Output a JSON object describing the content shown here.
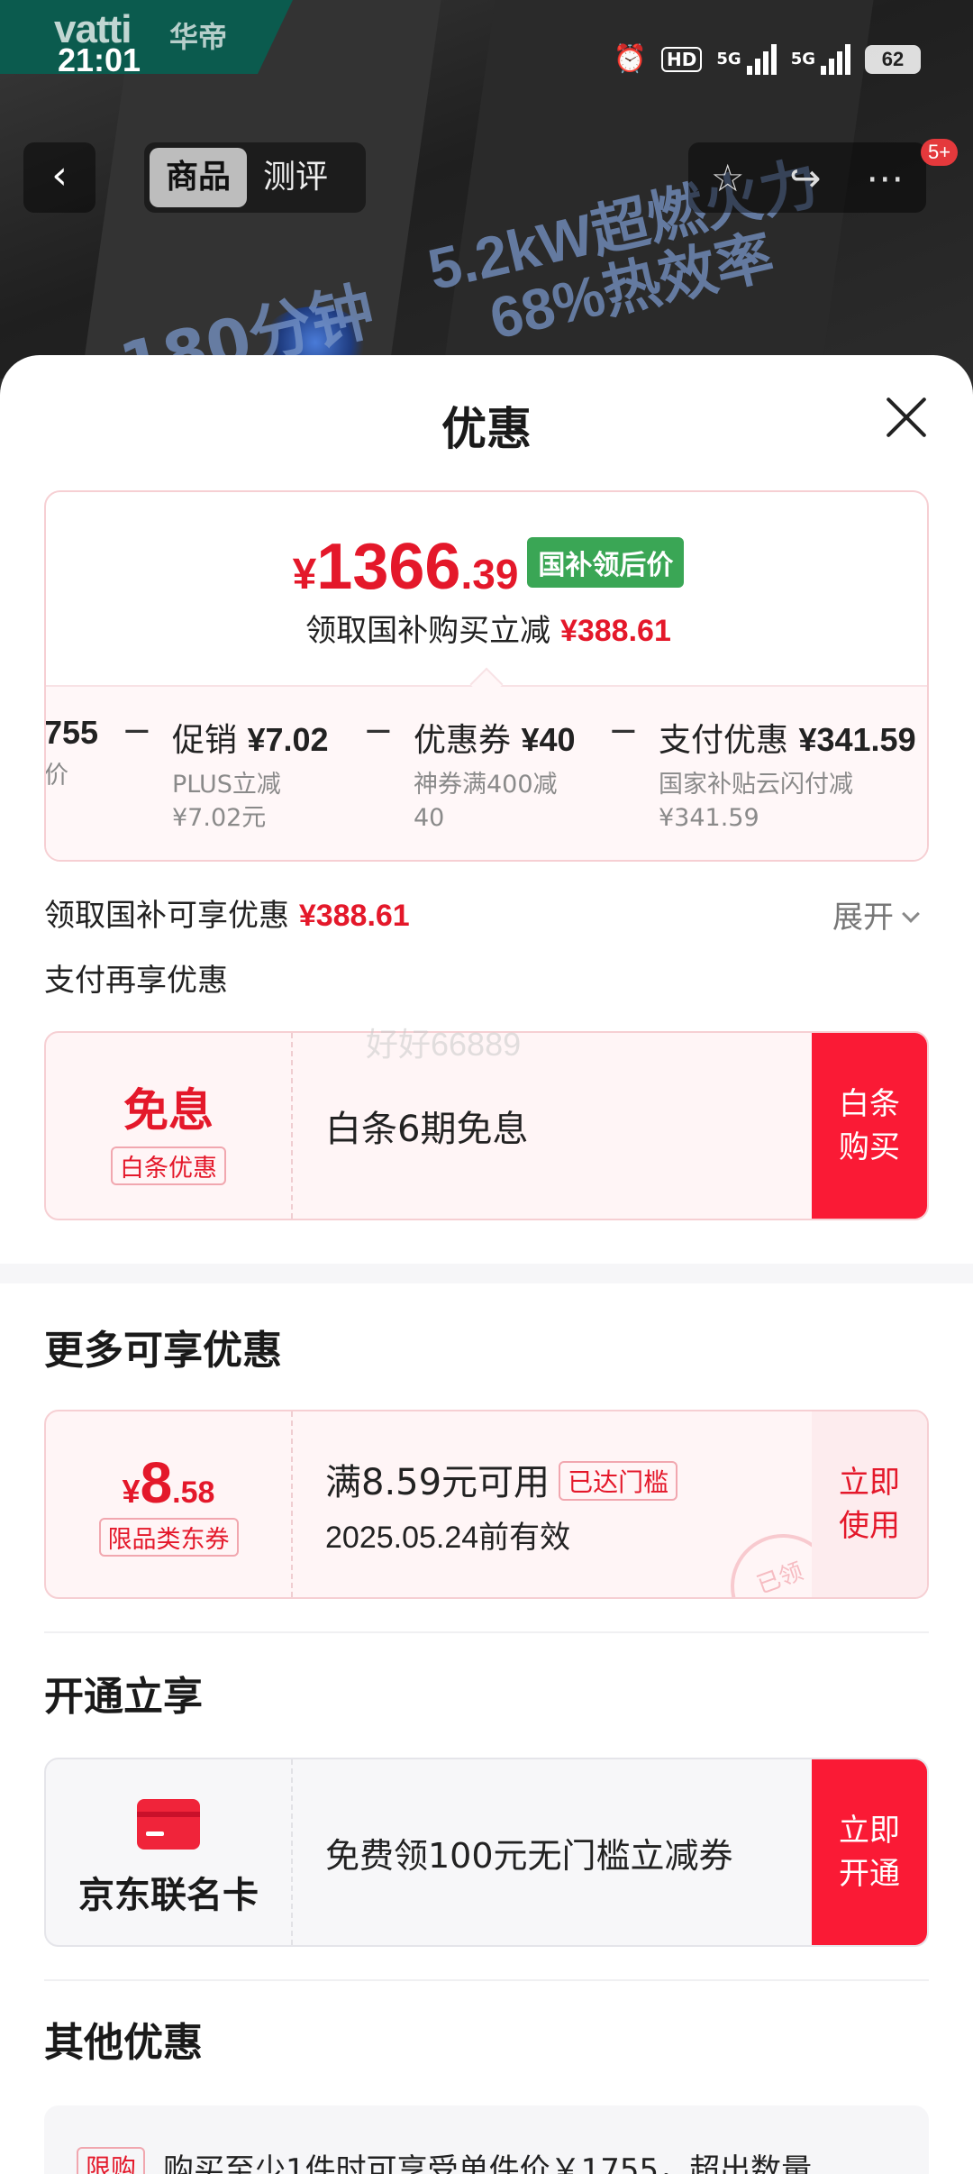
{
  "status_bar": {
    "time": "21:01",
    "battery": "62",
    "hd": "HD",
    "net1": "5G",
    "net2": "5G"
  },
  "brand": {
    "logo": "vatti",
    "cn": "华帝"
  },
  "hero": {
    "promo1": "5.2kW超燃火力",
    "promo2": "68%热效率",
    "promo3": "180分钟"
  },
  "nav": {
    "back": "‹",
    "tabs": [
      "商品",
      "测评"
    ],
    "badge": "5+"
  },
  "sheet": {
    "title": "优惠"
  },
  "price": {
    "yen": "¥",
    "integer": "1366",
    "decimal": ".39",
    "tag": "国补领后价",
    "sub_label": "领取国补购买立减",
    "sub_amount": "¥388.61"
  },
  "calc": [
    {
      "title_label": "",
      "title_value": "755",
      "desc": "价"
    },
    {
      "op": "−"
    },
    {
      "title_label": "促销",
      "title_value": "¥7.02",
      "desc": "PLUS立减 ¥7.02元"
    },
    {
      "op": "−"
    },
    {
      "title_label": "优惠券",
      "title_value": "¥40",
      "desc": "神券满400减 40"
    },
    {
      "op": "−"
    },
    {
      "title_label": "支付优惠",
      "title_value": "¥341.59",
      "desc": "国家补贴云闪付减 ¥341.59"
    }
  ],
  "summary": {
    "label": "领取国补可享优惠",
    "amount": "¥388.61",
    "expand": "展开"
  },
  "pay_section": {
    "title": "支付再享优惠"
  },
  "baitiao": {
    "big": "免息",
    "tag": "白条优惠",
    "text": "白条6期免息",
    "action": "白条购买"
  },
  "watermark": "好好66889",
  "more": {
    "title": "更多可享优惠",
    "coupon": {
      "yen": "¥",
      "int": "8",
      "dec": ".58",
      "tag": "限品类东券",
      "condition": "满8.59元可用",
      "threshold_tag": "已达门槛",
      "expiry": "2025.05.24前有效",
      "stamp": "已领",
      "action": "立即使用"
    }
  },
  "open": {
    "title": "开通立享",
    "card_name": "京东联名卡",
    "text": "免费领100元无门槛立减券",
    "action": "立即开通"
  },
  "other": {
    "title": "其他优惠",
    "tag": "限购",
    "text": "购买至少1件时可享受单件价￥1755，超出数量"
  }
}
